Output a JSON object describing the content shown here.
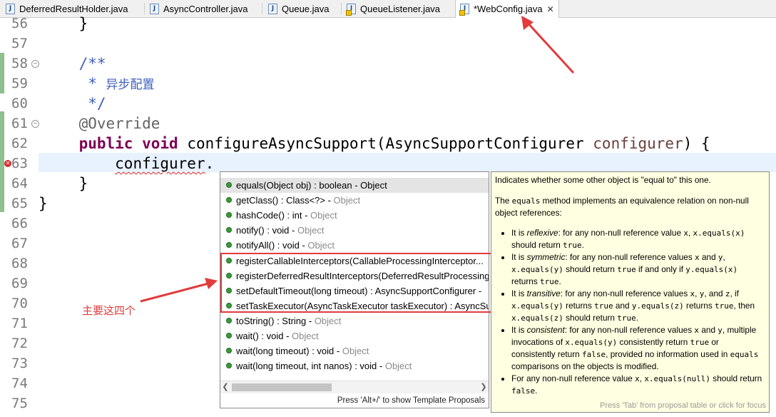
{
  "tabs": [
    {
      "label": "DeferredResultHolder.java"
    },
    {
      "label": "AsyncController.java"
    },
    {
      "label": "Queue.java"
    },
    {
      "label": "QueueListener.java"
    },
    {
      "label": "*WebConfig.java",
      "close": "✕"
    }
  ],
  "editor": {
    "line_numbers": [
      "56",
      "57",
      "58",
      "59",
      "60",
      "61",
      "62",
      "63",
      "64",
      "65",
      "66",
      "67",
      "68",
      "69",
      "70",
      "71",
      "72",
      "73",
      "74",
      "75"
    ],
    "code": {
      "l56": "    }",
      "l58": "    /**",
      "l59_star": "     * ",
      "l59_text": "异步配置",
      "l60": "     */",
      "l61": "    @Override",
      "l62_kw1": "public",
      "l62_kw2": "void",
      "l62_method": "configureAsyncSupport(AsyncSupportConfigurer ",
      "l62_param": "configurer",
      "l62_end": ") {",
      "l63_var": "configurer",
      "l63_dot": ".",
      "l64": "    }",
      "l65": "}"
    }
  },
  "proposals": {
    "items": [
      {
        "sig": "equals(Object obj) : boolean - Object",
        "owner": ""
      },
      {
        "sig": "getClass() : Class<?> - ",
        "owner": "Object"
      },
      {
        "sig": "hashCode() : int - ",
        "owner": "Object"
      },
      {
        "sig": "notify() : void - ",
        "owner": "Object"
      },
      {
        "sig": "notifyAll() : void - ",
        "owner": "Object"
      },
      {
        "sig": "registerCallableInterceptors(CallableProcessingInterceptor...",
        "owner": ""
      },
      {
        "sig": "registerDeferredResultInterceptors(DeferredResultProcessing",
        "owner": ""
      },
      {
        "sig": "setDefaultTimeout(long timeout) : AsyncSupportConfigurer - ",
        "owner": ""
      },
      {
        "sig": "setTaskExecutor(AsyncTaskExecutor taskExecutor) : AsyncSup",
        "owner": ""
      },
      {
        "sig": "toString() : String - ",
        "owner": "Object"
      },
      {
        "sig": "wait() : void - ",
        "owner": "Object"
      },
      {
        "sig": "wait(long timeout) : void - ",
        "owner": "Object"
      },
      {
        "sig": "wait(long timeout, int nanos) : void - ",
        "owner": "Object"
      }
    ],
    "status": "Press 'Alt+/' to show Template Proposals"
  },
  "doc": {
    "p1": "Indicates whether some other object is \"equal to\" this one.",
    "p2a": "The ",
    "p2code": "equals",
    "p2b": " method implements an equivalence relation on non-null object references:",
    "b1": {
      "a": "It is ",
      "em": "reflexive",
      "b": ": for any non-null reference value ",
      "c1": "x",
      "c": ", ",
      "c2": "x.equals(x)",
      "d": " should return ",
      "c3": "true",
      "e": "."
    },
    "b2": {
      "a": "It is ",
      "em": "symmetric",
      "b": ": for any non-null reference values ",
      "c1": "x",
      "c": " and ",
      "c2": "y",
      "d": ", ",
      "c3": "x.equals(y)",
      "e": " should return ",
      "c4": "true",
      "f": " if and only if ",
      "c5": "y.equals(x)",
      "g": " returns ",
      "c6": "true",
      "h": "."
    },
    "b3": {
      "a": "It is ",
      "em": "transitive",
      "b": ": for any non-null reference values ",
      "c1": "x",
      "c": ", ",
      "c2": "y",
      "d": ", and ",
      "c3": "z",
      "e": ", if ",
      "c4": "x.equals(y)",
      "f": " returns ",
      "c5": "true",
      "g": " and ",
      "c6": "y.equals(z)",
      "h": " returns ",
      "c7": "true",
      "i": ", then ",
      "c8": "x.equals(z)",
      "j": " should return ",
      "c9": "true",
      "k": "."
    },
    "b4": {
      "a": "It is ",
      "em": "consistent",
      "b": ": for any non-null reference values ",
      "c1": "x",
      "c": " and ",
      "c2": "y",
      "d": ", multiple invocations of ",
      "c3": "x.equals(y)",
      "e": " consistently return ",
      "c4": "true",
      "f": " or consistently return ",
      "c5": "false",
      "g": ", provided no information used in ",
      "c6": "equals",
      "h": " comparisons on the objects is modified."
    },
    "b5": {
      "a": "For any non-null reference value ",
      "c1": "x",
      "b": ", ",
      "c2": "x.equals(null)",
      "c": " should return ",
      "c3": "false",
      "d": "."
    },
    "status": "Press 'Tab' from proposal table or click for focus"
  },
  "annotation": {
    "text": "主要这四个",
    "color": "#e23b3b"
  },
  "colors": {
    "keyword": "#7f0055",
    "comment": "#3f5fbf",
    "annotation_red": "#e23b3b"
  }
}
